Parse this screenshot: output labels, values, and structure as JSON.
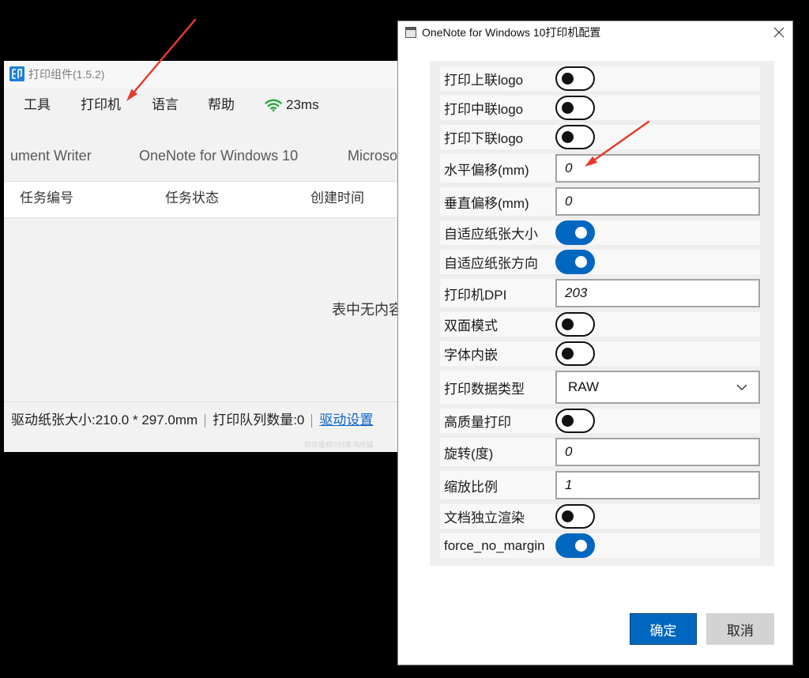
{
  "left_window": {
    "title": "打印组件(1.5.2)",
    "menu": [
      "工具",
      "打印机",
      "语言",
      "帮助"
    ],
    "latency": "23ms",
    "tabs": [
      "ument Writer",
      "OneNote for Windows 10",
      "Microso"
    ],
    "columns": [
      "任务编号",
      "任务状态",
      "创建时间"
    ],
    "empty_text": "表中无内容",
    "status": {
      "paper_size": "驱动纸张大小:210.0 * 297.0mm",
      "queue_count": "打印队列数量:0",
      "driver_settings_link": "驱动设置"
    },
    "copyright": "软件版权©归客鸟所属"
  },
  "dialog": {
    "title": "OneNote for Windows 10打印机配置",
    "rows": [
      {
        "label": "打印上联logo",
        "on": false
      },
      {
        "label": "打印中联logo",
        "on": false
      },
      {
        "label": "打印下联logo",
        "on": false
      },
      {
        "label": "水平偏移(mm)",
        "value": "0"
      },
      {
        "label": "垂直偏移(mm)",
        "value": "0"
      },
      {
        "label": "自适应纸张大小",
        "on": true
      },
      {
        "label": "自适应纸张方向",
        "on": true
      },
      {
        "label": "打印机DPI",
        "value": "203"
      },
      {
        "label": "双面模式",
        "on": false
      },
      {
        "label": "字体内嵌",
        "on": false
      },
      {
        "label": "打印数据类型",
        "value": "RAW"
      },
      {
        "label": "高质量打印",
        "on": false
      },
      {
        "label": "旋转(度)",
        "value": "0"
      },
      {
        "label": "缩放比例",
        "value": "1"
      },
      {
        "label": "文档独立渲染",
        "on": false
      },
      {
        "label": "force_no_margin",
        "on": true
      }
    ],
    "ok_label": "确定",
    "cancel_label": "取消"
  },
  "colors": {
    "accent": "#0067c0",
    "link": "#0a64c8",
    "signal": "#2aa83a",
    "annotation_arrow": "#e53a2b"
  },
  "icons": [
    "app-logo-icon",
    "wifi-signal-icon",
    "window-icon",
    "close-icon",
    "chevron-down-icon",
    "red-arrow-icon"
  ]
}
